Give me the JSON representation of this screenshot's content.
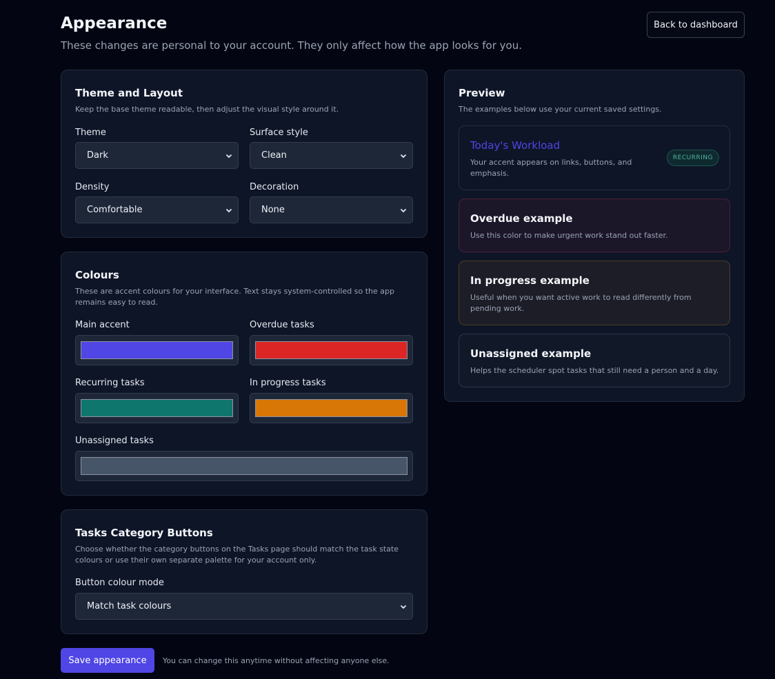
{
  "page": {
    "title": "Appearance",
    "subtitle": "These changes are personal to your account. They only affect how the app looks for you.",
    "back_label": "Back to dashboard"
  },
  "theme_layout": {
    "title": "Theme and Layout",
    "description": "Keep the base theme readable, then adjust the visual style around it.",
    "theme": {
      "label": "Theme",
      "value": "Dark"
    },
    "surface": {
      "label": "Surface style",
      "value": "Clean"
    },
    "density": {
      "label": "Density",
      "value": "Comfortable"
    },
    "decoration": {
      "label": "Decoration",
      "value": "None"
    }
  },
  "colours": {
    "title": "Colours",
    "description": "These are accent colours for your interface. Text stays system-controlled so the app remains easy to read.",
    "main_accent": {
      "label": "Main accent",
      "color": "#4f46e5"
    },
    "overdue": {
      "label": "Overdue tasks",
      "color": "#dc2626"
    },
    "recurring": {
      "label": "Recurring tasks",
      "color": "#0f766e"
    },
    "in_progress": {
      "label": "In progress tasks",
      "color": "#d97706"
    },
    "unassigned": {
      "label": "Unassigned tasks",
      "color": "#475569"
    }
  },
  "category_buttons": {
    "title": "Tasks Category Buttons",
    "description": "Choose whether the category buttons on the Tasks page should match the task state colours or use their own separate palette for your account only.",
    "mode": {
      "label": "Button colour mode",
      "value": "Match task colours"
    }
  },
  "preview": {
    "title": "Preview",
    "description": "The examples below use your current saved settings.",
    "workload": {
      "title": "Today's Workload",
      "description": "Your accent appears on links, buttons, and emphasis.",
      "badge": "RECURRING"
    },
    "overdue": {
      "title": "Overdue example",
      "description": "Use this color to make urgent work stand out faster."
    },
    "in_progress": {
      "title": "In progress example",
      "description": "Useful when you want active work to read differently from pending work."
    },
    "unassigned": {
      "title": "Unassigned example",
      "description": "Helps the scheduler spot tasks that still need a person and a day."
    }
  },
  "footer": {
    "save_label": "Save appearance",
    "note": "You can change this anytime without affecting anyone else."
  }
}
